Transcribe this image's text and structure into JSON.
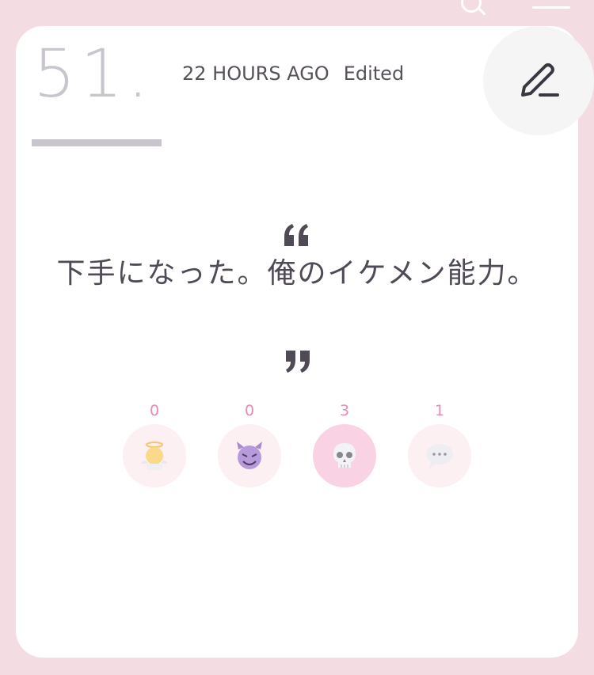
{
  "header": {
    "search_icon": "search-icon",
    "menu_icon": "menu-icon"
  },
  "post": {
    "number": "51.",
    "time_ago": "22 HOURS AGO",
    "edited_label": "Edited",
    "edit_icon": "pencil-icon",
    "text": "下手になった。俺のイケメン能力。"
  },
  "reactions": [
    {
      "name": "angel",
      "icon": "angel-icon",
      "count": "0",
      "active": false
    },
    {
      "name": "devil",
      "icon": "devil-icon",
      "count": "0",
      "active": false
    },
    {
      "name": "skull",
      "icon": "skull-icon",
      "count": "3",
      "active": true
    },
    {
      "name": "comment",
      "icon": "speech-bubble-icon",
      "count": "1",
      "active": false
    }
  ],
  "colors": {
    "background": "#f4dde2",
    "card": "#ffffff",
    "text": "#4f4a55",
    "muted": "#c9c5cc",
    "reaction_count": "#e58bb6",
    "reaction_bg": "#fdf0f3",
    "reaction_active_bg": "#f9d3e3"
  }
}
